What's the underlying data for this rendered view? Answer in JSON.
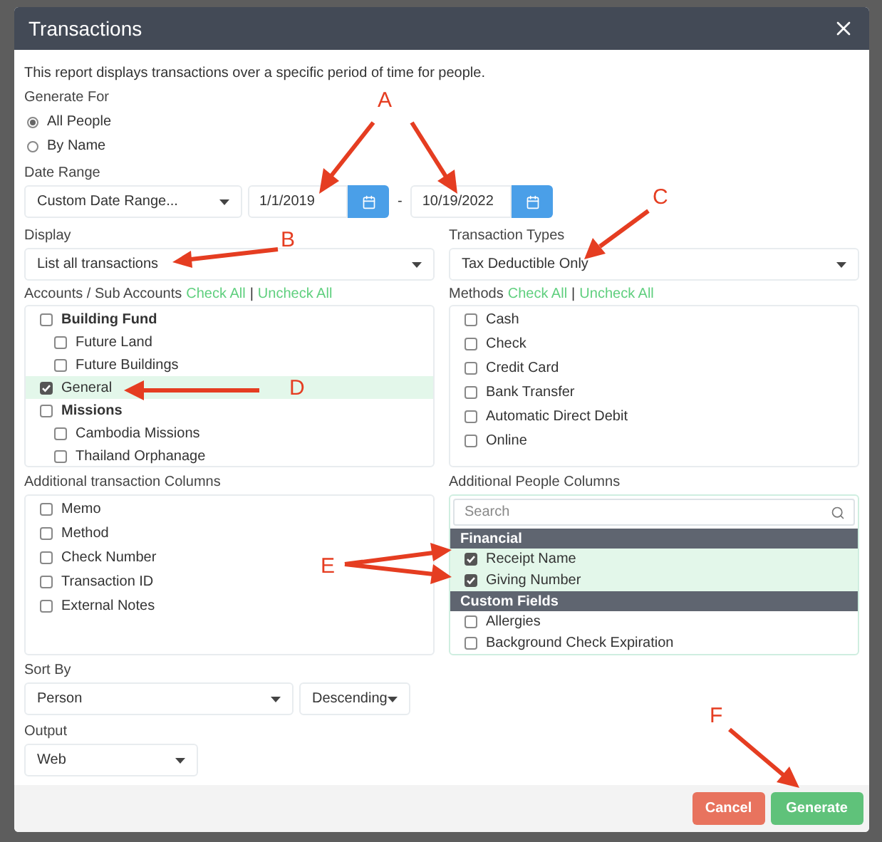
{
  "window": {
    "title": "Transactions"
  },
  "description": "This report displays transactions over a specific period of time for people.",
  "generate_for": {
    "label": "Generate For",
    "options": [
      {
        "label": "All People",
        "selected": true
      },
      {
        "label": "By Name",
        "selected": false
      }
    ]
  },
  "date_range": {
    "label": "Date Range",
    "preset": "Custom Date Range...",
    "start": "1/1/2019",
    "separator": "-",
    "end": "10/19/2022"
  },
  "display": {
    "label": "Display",
    "value": "List all transactions"
  },
  "transaction_types": {
    "label": "Transaction Types",
    "value": "Tax Deductible Only"
  },
  "accounts": {
    "label": "Accounts / Sub Accounts",
    "check_all": "Check All",
    "separator": "|",
    "uncheck_all": "Uncheck All",
    "items": [
      {
        "label": "Building Fund",
        "checked": false,
        "children": [
          {
            "label": "Future Land",
            "checked": false
          },
          {
            "label": "Future Buildings",
            "checked": false
          }
        ]
      },
      {
        "label": "General",
        "checked": true
      },
      {
        "label": "Missions",
        "checked": false,
        "children": [
          {
            "label": "Cambodia Missions",
            "checked": false
          },
          {
            "label": "Thailand Orphanage",
            "checked": false
          }
        ]
      }
    ]
  },
  "methods": {
    "label": "Methods",
    "check_all": "Check All",
    "separator": "|",
    "uncheck_all": "Uncheck All",
    "items": [
      {
        "label": "Cash",
        "checked": false
      },
      {
        "label": "Check",
        "checked": false
      },
      {
        "label": "Credit Card",
        "checked": false
      },
      {
        "label": "Bank Transfer",
        "checked": false
      },
      {
        "label": "Automatic Direct Debit",
        "checked": false
      },
      {
        "label": "Online",
        "checked": false
      }
    ]
  },
  "transaction_columns": {
    "label": "Additional transaction Columns",
    "items": [
      {
        "label": "Memo",
        "checked": false
      },
      {
        "label": "Method",
        "checked": false
      },
      {
        "label": "Check Number",
        "checked": false
      },
      {
        "label": "Transaction ID",
        "checked": false
      },
      {
        "label": "External Notes",
        "checked": false
      }
    ]
  },
  "people_columns": {
    "label": "Additional People Columns",
    "search": {
      "placeholder": "Search"
    },
    "groups": [
      {
        "title": "Financial",
        "items": [
          {
            "label": "Receipt Name",
            "checked": true
          },
          {
            "label": "Giving Number",
            "checked": true
          }
        ]
      },
      {
        "title": "Custom Fields",
        "items": [
          {
            "label": "Allergies",
            "checked": false
          },
          {
            "label": "Background Check Expiration",
            "checked": false
          }
        ]
      }
    ]
  },
  "sort_by": {
    "label": "Sort By",
    "field": "Person",
    "direction": "Descending"
  },
  "output": {
    "label": "Output",
    "value": "Web"
  },
  "buttons": [
    {
      "label": "Cancel",
      "kind": "cancel"
    },
    {
      "label": "Generate",
      "kind": "primary"
    }
  ],
  "annotations": [
    {
      "letter": "A"
    },
    {
      "letter": "B"
    },
    {
      "letter": "C"
    },
    {
      "letter": "D"
    },
    {
      "letter": "E"
    },
    {
      "letter": "F"
    }
  ]
}
